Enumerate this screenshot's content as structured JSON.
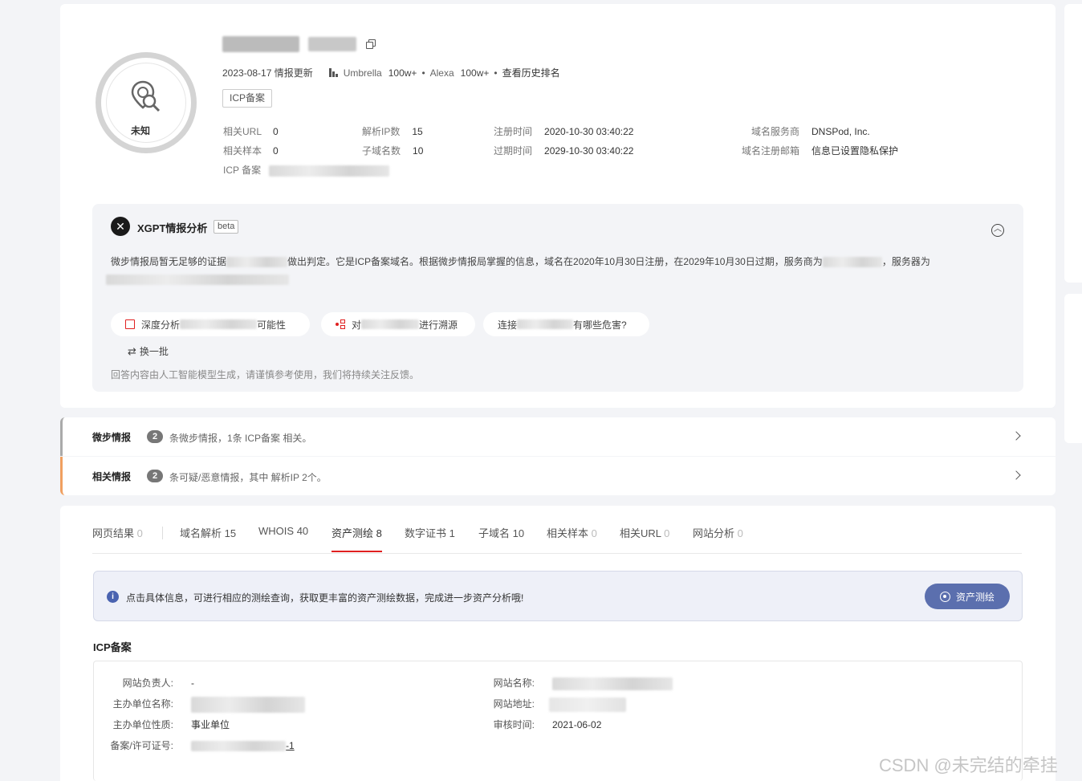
{
  "header": {
    "update_date": "2023-08-17 情报更新",
    "umbrella_label": "Umbrella",
    "umbrella_value": "100w+",
    "alexa_label": "Alexa",
    "alexa_value": "100w+",
    "history_rank": "查看历史排名",
    "icp_tag": "ICP备案",
    "status": "未知",
    "bullet": "•"
  },
  "stats": {
    "related_url_label": "相关URL",
    "related_url": "0",
    "related_sample_label": "相关样本",
    "related_sample": "0",
    "icp_label": "ICP 备案",
    "resolve_ip_label": "解析IP数",
    "resolve_ip": "15",
    "subdomain_label": "子域名数",
    "subdomain": "10",
    "reg_time_label": "注册时间",
    "reg_time": "2020-10-30 03:40:22",
    "exp_time_label": "过期时间",
    "exp_time": "2029-10-30 03:40:22",
    "registrar_label": "域名服务商",
    "registrar": "DNSPod, Inc.",
    "reg_email_label": "域名注册邮箱",
    "reg_email": "信息已设置隐私保护"
  },
  "xgpt": {
    "title": "XGPT情报分析",
    "beta": "beta",
    "text_a": "微步情报局暂无足够的证据",
    "text_b": "做出判定。它是ICP备案域名。根据微步情报局掌握的信息，域名在2020年10月30日注册，在2029年10月30日过期，服务商为",
    "text_c": "，服务器为",
    "chip1_a": "深度分析",
    "chip1_b": "可能性",
    "chip2_a": "对",
    "chip2_b": "进行溯源",
    "chip3_a": "连接",
    "chip3_b": "有哪些危害?",
    "refresh": "换一批",
    "disclaimer": "回答内容由人工智能模型生成，请谨慎参考使用，我们将持续关注反馈。"
  },
  "intel": [
    {
      "title": "微步情报",
      "count": "2",
      "desc": "条微步情报，1条 ICP备案 相关。"
    },
    {
      "title": "相关情报",
      "count": "2",
      "desc": "条可疑/恶意情报，其中 解析IP 2个。"
    }
  ],
  "tabs": [
    {
      "label": "网页结果",
      "count": "0"
    },
    {
      "label": "域名解析",
      "count": "15"
    },
    {
      "label": "WHOIS",
      "count": "40"
    },
    {
      "label": "资产测绘",
      "count": "8"
    },
    {
      "label": "数字证书",
      "count": "1"
    },
    {
      "label": "子域名",
      "count": "10"
    },
    {
      "label": "相关样本",
      "count": "0"
    },
    {
      "label": "相关URL",
      "count": "0"
    },
    {
      "label": "网站分析",
      "count": "0"
    }
  ],
  "notice": {
    "text": "点击具体信息，可进行相应的测绘查询，获取更丰富的资产测绘数据，完成进一步资产分析哦!",
    "button": "资产测绘"
  },
  "icp": {
    "section_title": "ICP备案",
    "owner_label": "网站负责人:",
    "owner": "-",
    "org_label": "主办单位名称:",
    "org_type_label": "主办单位性质:",
    "org_type": "事业单位",
    "license_label": "备案/许可证号:",
    "license_suffix": "-1",
    "site_name_label": "网站名称:",
    "site_url_label": "网站地址:",
    "audit_label": "审核时间:",
    "audit_time": "2021-06-02"
  },
  "watermark": "CSDN @未完结的牵挂",
  "colors": {
    "accent": "#e02020",
    "button": "#5b6fae",
    "orange": "#f0a060"
  }
}
